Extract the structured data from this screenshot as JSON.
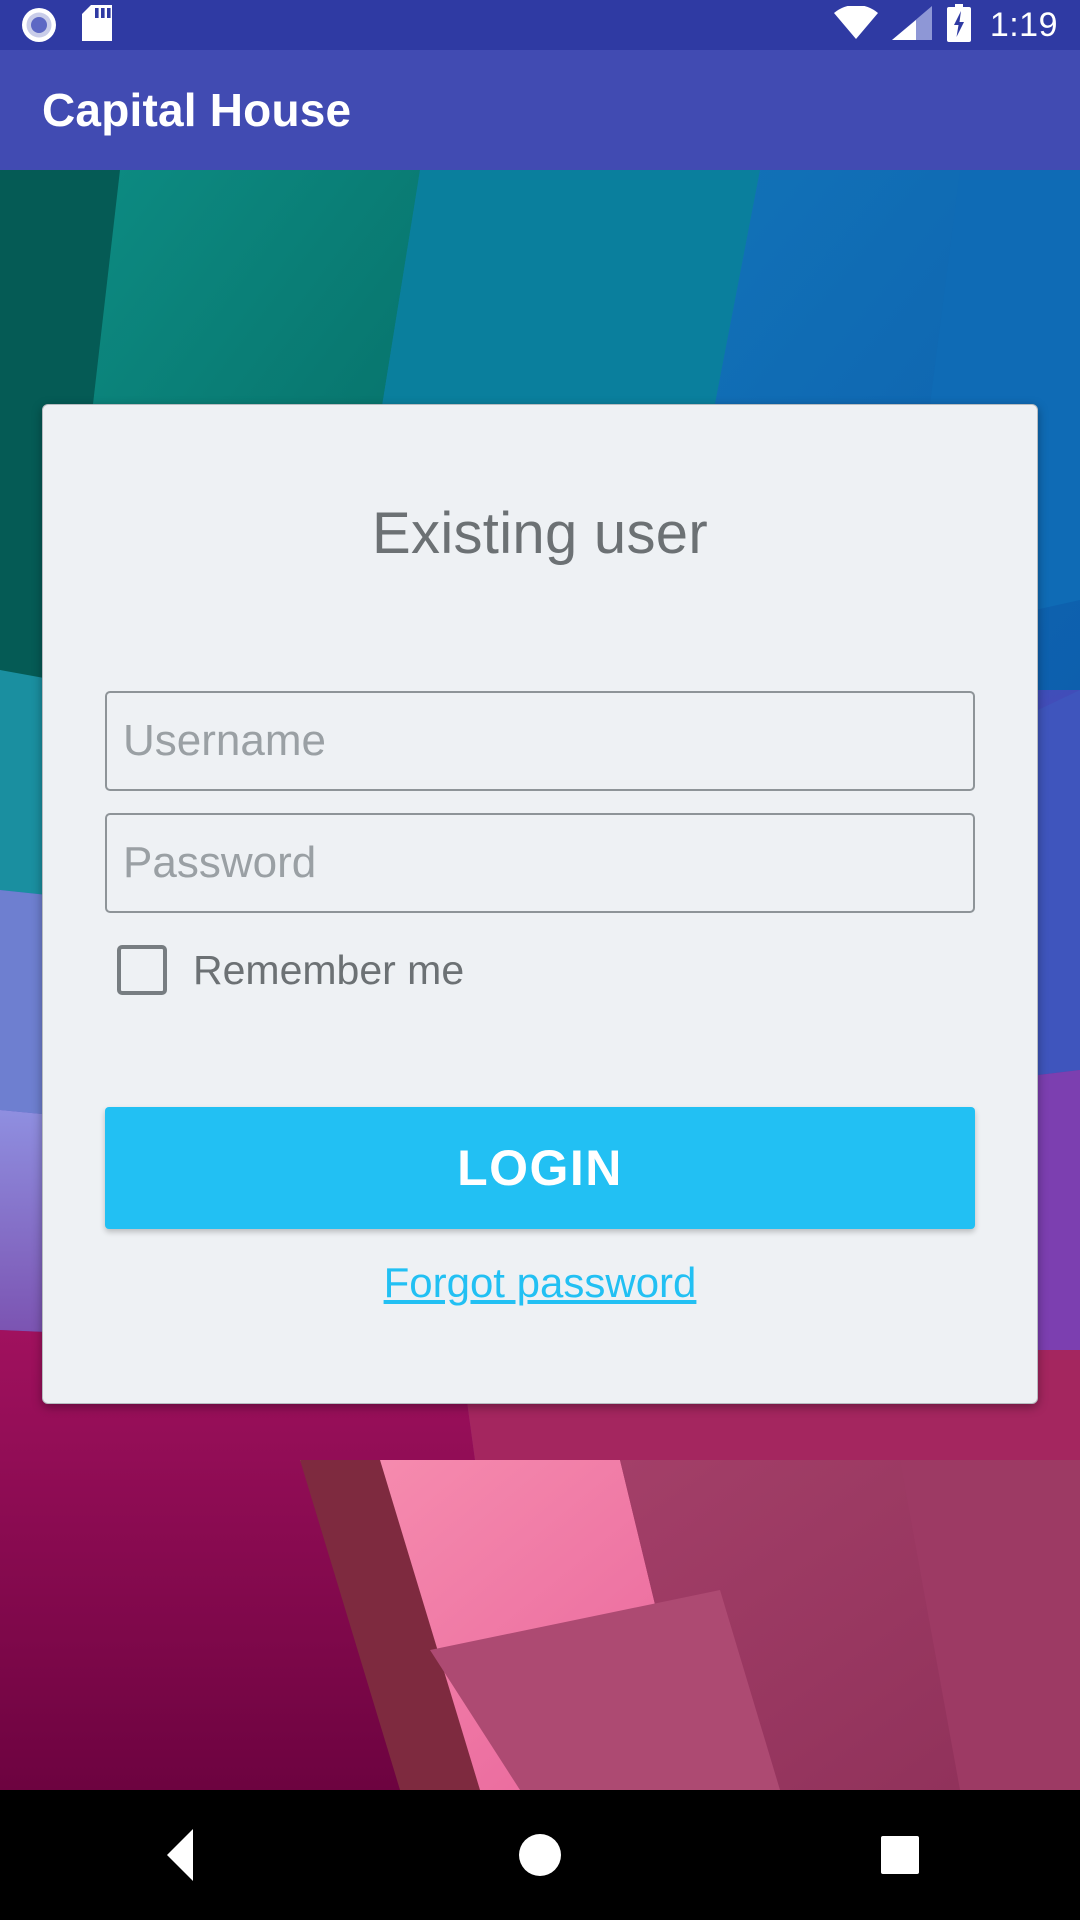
{
  "status_bar": {
    "time": "1:19",
    "icons": {
      "cast": "cast-icon",
      "sd_card": "sd-card-icon",
      "wifi": "wifi-icon",
      "cellular": "cellular-signal-icon",
      "battery": "battery-charging-icon"
    },
    "background_color": "#2f3aa3"
  },
  "app_bar": {
    "title": "Capital House",
    "background_color": "#414bb2",
    "text_color": "#ffffff"
  },
  "login_card": {
    "heading": "Existing user",
    "background_color": "#eef1f4",
    "username": {
      "placeholder": "Username",
      "value": ""
    },
    "password": {
      "placeholder": "Password",
      "value": ""
    },
    "remember_me": {
      "label": "Remember me",
      "checked": false
    },
    "login_button": {
      "label": "LOGIN",
      "color": "#22c0f3",
      "text_color": "#ffffff"
    },
    "forgot_password": {
      "label": "Forgot password",
      "color": "#22c0f3"
    }
  },
  "nav_bar": {
    "back": "back-nav-icon",
    "home": "home-nav-icon",
    "recent": "recent-apps-nav-icon",
    "background_color": "#000000"
  }
}
